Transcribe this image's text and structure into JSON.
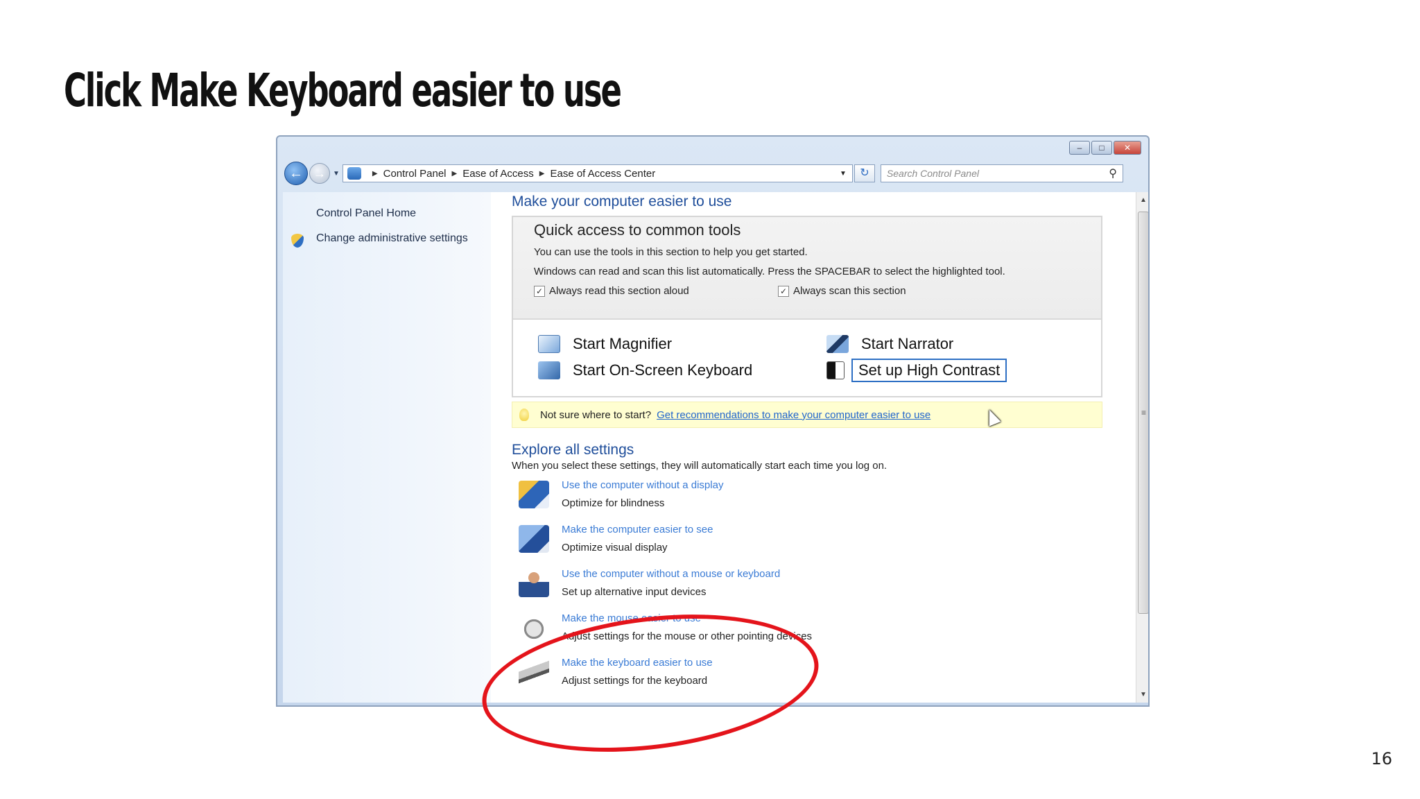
{
  "slide": {
    "title": "Click Make Keyboard easier to use",
    "number": "16"
  },
  "window": {
    "controls": {
      "minimize": "–",
      "maximize": "□",
      "close": "✕"
    },
    "nav": {
      "back": "←",
      "forward": "→",
      "breadcrumbs": [
        "Control Panel",
        "Ease of Access",
        "Ease of Access Center"
      ],
      "search_placeholder": "Search Control Panel"
    },
    "sidebar": {
      "home": "Control Panel Home",
      "admin": "Change administrative settings"
    },
    "content": {
      "heading": "Make your computer easier to use",
      "quick": {
        "title": "Quick access to common tools",
        "line1": "You can use the tools in this section to help you get started.",
        "line2": "Windows can read and scan this list automatically.  Press the SPACEBAR to select the highlighted tool.",
        "cb_read": "Always read this section aloud",
        "cb_scan": "Always scan this section",
        "tools": {
          "magnifier": "Start Magnifier",
          "narrator": "Start Narrator",
          "osk": "Start On-Screen Keyboard",
          "contrast": "Set up High Contrast"
        }
      },
      "tip": {
        "text": "Not sure where to start?",
        "link": "Get recommendations to make your computer easier to use"
      },
      "explore": {
        "heading": "Explore all settings",
        "desc": "When you select these settings, they will automatically start each time you log on.",
        "items": [
          {
            "link": "Use the computer without a display",
            "desc": "Optimize for blindness",
            "icon": "blindness-icon"
          },
          {
            "link": "Make the computer easier to see",
            "desc": "Optimize visual display",
            "icon": "visual-display-icon"
          },
          {
            "link": "Use the computer without a mouse or keyboard",
            "desc": "Set up alternative input devices",
            "icon": "alt-input-icon"
          },
          {
            "link": "Make the mouse easier to use",
            "desc": "Adjust settings for the mouse or other pointing devices",
            "icon": "mouse-icon"
          },
          {
            "link": "Make the keyboard easier to use",
            "desc": "Adjust settings for the keyboard",
            "icon": "keyboard-icon"
          }
        ]
      }
    }
  },
  "annotation_color": "#e4141b"
}
